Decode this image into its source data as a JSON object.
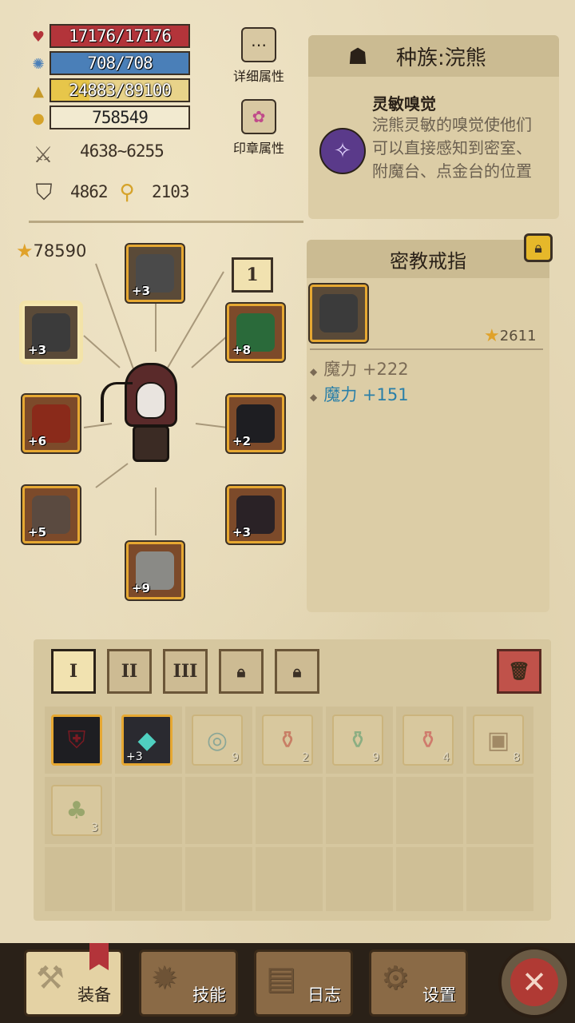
{
  "stats": {
    "hp": "17176/17176",
    "mp": "708/708",
    "xp": "24883/89100",
    "xp_progress": 0.279,
    "gold": "758549",
    "attack": "4638~6255",
    "defense": "4862",
    "keys": "2103"
  },
  "side_buttons": {
    "detail": "详细属性",
    "seal": "印章属性"
  },
  "race": {
    "title": "种族:浣熊",
    "skill_name": "灵敏嗅觉",
    "skill_desc": "浣熊灵敏的嗅觉使他们可以直接感知到密室、附魔台、点金台的位置"
  },
  "hero": {
    "score": "78590",
    "page_badge": "1"
  },
  "equipment": [
    {
      "slot": "helmet",
      "level": "+3"
    },
    {
      "slot": "ring",
      "level": "+3"
    },
    {
      "slot": "amulet",
      "level": "+8"
    },
    {
      "slot": "weapon",
      "level": "+6"
    },
    {
      "slot": "armor",
      "level": "+2"
    },
    {
      "slot": "gloves",
      "level": "+5"
    },
    {
      "slot": "shield",
      "level": "+3"
    },
    {
      "slot": "boots",
      "level": "+9"
    }
  ],
  "selected_item": {
    "name": "密教戒指",
    "score": "2611",
    "attrs": [
      "魔力 +222",
      "魔力 +151"
    ],
    "colors": {
      "attr1": "#7a6a55",
      "attr2": "#2a7fa8"
    }
  },
  "inventory_tabs": [
    "I",
    "II",
    "III"
  ],
  "inventory": [
    {
      "icon": "armor-icon",
      "count": ""
    },
    {
      "icon": "helmet-icon",
      "count": "+3"
    },
    {
      "icon": "map-icon",
      "count": "9"
    },
    {
      "icon": "red-potion-icon",
      "count": "2"
    },
    {
      "icon": "green-potion-icon",
      "count": "9"
    },
    {
      "icon": "red-potion-icon",
      "count": "4"
    },
    {
      "icon": "chest-icon",
      "count": "8"
    },
    {
      "icon": "tree-icon",
      "count": "3"
    }
  ],
  "nav": {
    "equip": "装备",
    "skill": "技能",
    "log": "日志",
    "settings": "设置"
  }
}
